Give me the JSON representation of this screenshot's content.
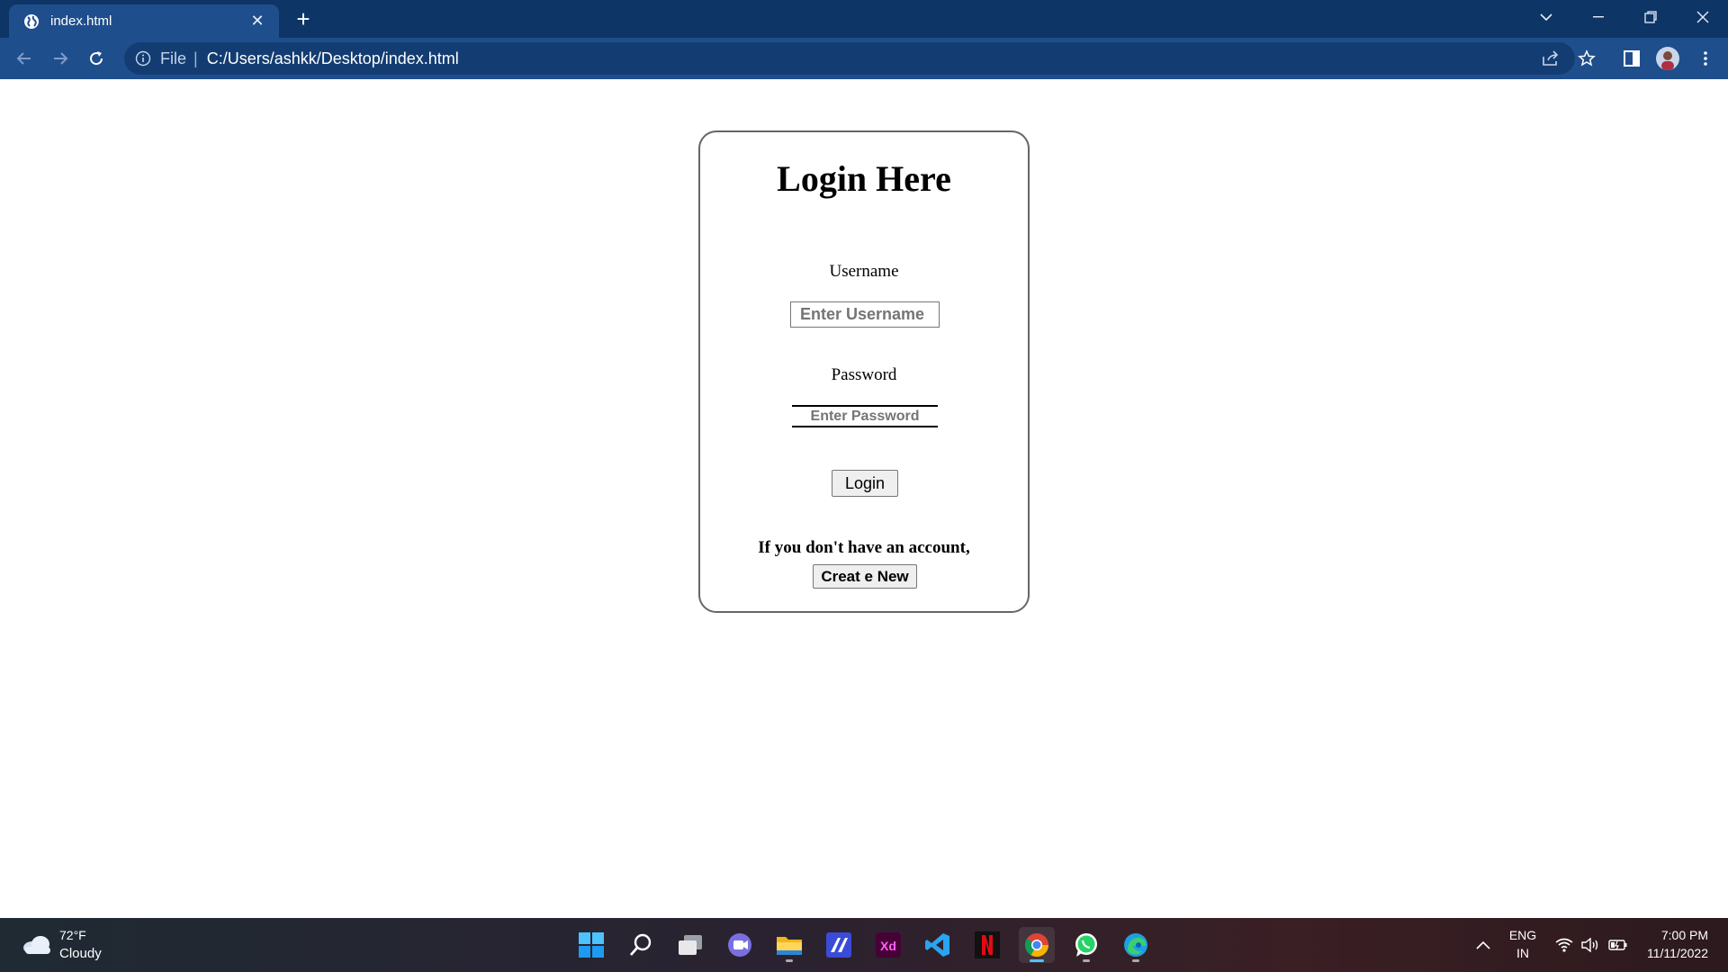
{
  "browser": {
    "tab_title": "index.html",
    "tab_close": "✕",
    "new_tab": "+",
    "address_scheme": "File",
    "address_separator": "|",
    "address_url": "C:/Users/ashkk/Desktop/index.html",
    "accent_color": "#1f4e8c"
  },
  "form": {
    "heading": "Login Here",
    "username_label": "Username",
    "username_placeholder": "Enter Username",
    "password_label": "Password",
    "password_placeholder": "Enter Password",
    "login_label": "Login",
    "account_text": "If you don't have an account,",
    "create_label": "Creat e New"
  },
  "taskbar": {
    "weather_temp": "72°F",
    "weather_condition": "Cloudy",
    "apps": [
      "start-icon",
      "search-icon",
      "task-view-icon",
      "teams-chat-icon",
      "file-explorer-icon",
      "dev-app-icon",
      "adobe-xd-icon",
      "vscode-icon",
      "netflix-icon",
      "chrome-icon",
      "whatsapp-icon",
      "edge-icon"
    ],
    "language_line1": "ENG",
    "language_line2": "IN",
    "time": "7:00 PM",
    "date": "11/11/2022"
  }
}
